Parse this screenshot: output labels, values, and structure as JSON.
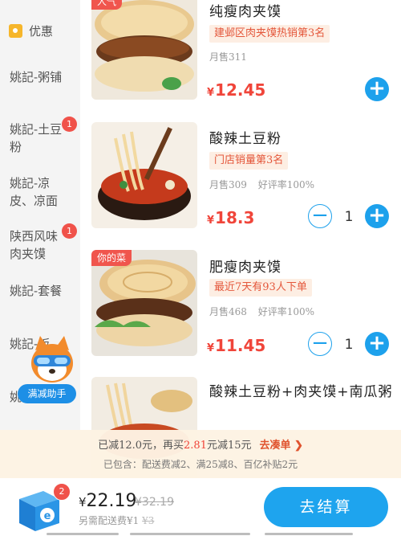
{
  "sidebar": {
    "items": [
      {
        "label": "优惠",
        "badge": ""
      },
      {
        "label": "姚記-粥铺",
        "badge": ""
      },
      {
        "label": "姚記-土豆粉",
        "badge": "1"
      },
      {
        "label": "姚記-凉皮、凉面",
        "badge": ""
      },
      {
        "label": "陕西风味肉夹馍",
        "badge": "1"
      },
      {
        "label": "姚記-套餐",
        "badge": ""
      },
      {
        "label": "姚記-饭",
        "badge": ""
      },
      {
        "label": "姚記-饺",
        "badge": ""
      }
    ]
  },
  "products": [
    {
      "name": "纯瘦肉夹馍",
      "tag": "人气",
      "rank": "建邺区肉夹馍热销第3名",
      "sales": "月售311",
      "rating": "",
      "currency": "¥",
      "price": "12.45",
      "qty": ""
    },
    {
      "name": "酸辣土豆粉",
      "tag": "",
      "rank": "门店销量第3名",
      "sales": "月售309",
      "rating": "好评率100%",
      "currency": "¥",
      "price": "18.3",
      "qty": "1"
    },
    {
      "name": "肥瘦肉夹馍",
      "tag": "你的菜",
      "rank": "最近7天有93人下单",
      "sales": "月售468",
      "rating": "好评率100%",
      "currency": "¥",
      "price": "11.45",
      "qty": "1"
    },
    {
      "name": "酸辣土豆粉+肉夹馍+南瓜粥",
      "tag": "",
      "rank": "",
      "sales": "",
      "rating": "",
      "currency": "",
      "price": "",
      "qty": ""
    }
  ],
  "mascot": {
    "label": "满减助手"
  },
  "banner": {
    "line1_a": "已减12.0元，再买",
    "line1_amount": "2.81",
    "line1_b": "元减15元",
    "line1_link": "去凑单 ❯",
    "line2": "已包含：配送费减2、满25减8、百亿补贴2元"
  },
  "cart": {
    "badge": "2",
    "currency": "¥",
    "total": "22.19",
    "original": "¥32.19",
    "delivery_prefix": "另需配送费¥1",
    "delivery_orig": "¥3",
    "checkout_label": "去结算"
  },
  "colors": {
    "accent_blue": "#1da1ec",
    "price_red": "#f0453a",
    "badge_red": "#f0524a",
    "banner_bg": "#fdf3e3"
  }
}
